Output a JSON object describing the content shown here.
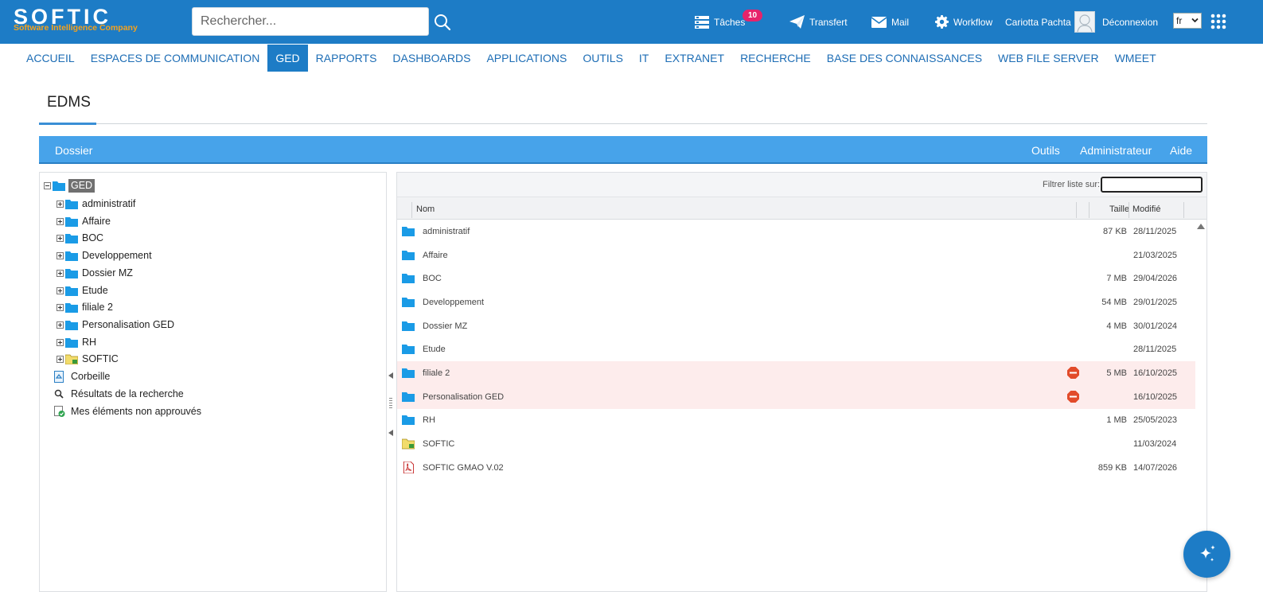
{
  "header": {
    "logo_text": "SOFTIC",
    "logo_tagline": "Software Intelligence Company",
    "search_placeholder": "Rechercher...",
    "tasks_label": "Tâches",
    "tasks_count": "10",
    "transfer_label": "Transfert",
    "mail_label": "Mail",
    "workflow_label": "Workflow",
    "user_name": "Cariotta Pachta",
    "logout_label": "Déconnexion",
    "language": "fr"
  },
  "nav": {
    "items": [
      "ACCUEIL",
      "ESPACES DE COMMUNICATION",
      "GED",
      "RAPPORTS",
      "DASHBOARDS",
      "APPLICATIONS",
      "OUTILS",
      "IT",
      "EXTRANET",
      "RECHERCHE",
      "BASE DES CONNAISSANCES",
      "WEB FILE SERVER",
      "WMEET"
    ],
    "active": "GED"
  },
  "page": {
    "title": "EDMS"
  },
  "toolbar": {
    "folder_label": "Dossier",
    "tools_label": "Outils",
    "admin_label": "Administrateur",
    "help_label": "Aide"
  },
  "tree": {
    "root": "GED",
    "folders": [
      "administratif",
      "Affaire",
      "BOC",
      "Developpement",
      "Dossier MZ",
      "Etude",
      "filiale 2",
      "Personalisation GED",
      "RH",
      "SOFTIC"
    ],
    "extras": [
      "Corbeille",
      "Résultats de la recherche",
      "Mes éléments non approuvés"
    ]
  },
  "list": {
    "filter_label": "Filtrer liste sur:",
    "filter_value": "",
    "columns": {
      "name": "Nom",
      "size": "Taille",
      "modified": "Modifié"
    },
    "rows": [
      {
        "name": "administratif",
        "size": "87 KB",
        "modified": "28/11/2025",
        "type": "folder",
        "locked": false
      },
      {
        "name": "Affaire",
        "size": "",
        "modified": "21/03/2025",
        "type": "folder",
        "locked": false
      },
      {
        "name": "BOC",
        "size": "7 MB",
        "modified": "29/04/2026",
        "type": "folder",
        "locked": false
      },
      {
        "name": "Developpement",
        "size": "54 MB",
        "modified": "29/01/2025",
        "type": "folder",
        "locked": false
      },
      {
        "name": "Dossier MZ",
        "size": "4 MB",
        "modified": "30/01/2024",
        "type": "folder",
        "locked": false
      },
      {
        "name": "Etude",
        "size": "",
        "modified": "28/11/2025",
        "type": "folder",
        "locked": false
      },
      {
        "name": "filiale 2",
        "size": "5 MB",
        "modified": "16/10/2025",
        "type": "folder",
        "locked": true
      },
      {
        "name": "Personalisation GED",
        "size": "",
        "modified": "16/10/2025",
        "type": "folder",
        "locked": true
      },
      {
        "name": "RH",
        "size": "1 MB",
        "modified": "25/05/2023",
        "type": "folder",
        "locked": false
      },
      {
        "name": "SOFTIC",
        "size": "",
        "modified": "11/03/2024",
        "type": "shared-folder",
        "locked": false
      },
      {
        "name": "SOFTIC GMAO V.02",
        "size": "859 KB",
        "modified": "14/07/2026",
        "type": "pdf",
        "locked": false
      }
    ]
  },
  "icons": {
    "tasks": "tasks-icon",
    "transfer": "paper-plane-icon",
    "mail": "envelope-icon",
    "workflow": "gear-icon",
    "apps": "grid-icon",
    "assistant": "sparkle-icon",
    "folder": "folder-icon",
    "shared_folder": "shared-folder-icon",
    "pdf": "pdf-icon",
    "locked": "stop-icon",
    "trash": "recycle-bin-icon",
    "search_results": "magnifier-icon",
    "unapproved": "check-document-icon"
  },
  "colors": {
    "header_bg": "#1d7cc6",
    "toolbar_bg": "#47a3ea",
    "nav_text": "#1d6db5",
    "folder_blue": "#1a9be6",
    "logo_orange": "#f7a21b",
    "badge_pink": "#e6236b",
    "locked_row_bg": "#fdecec"
  }
}
